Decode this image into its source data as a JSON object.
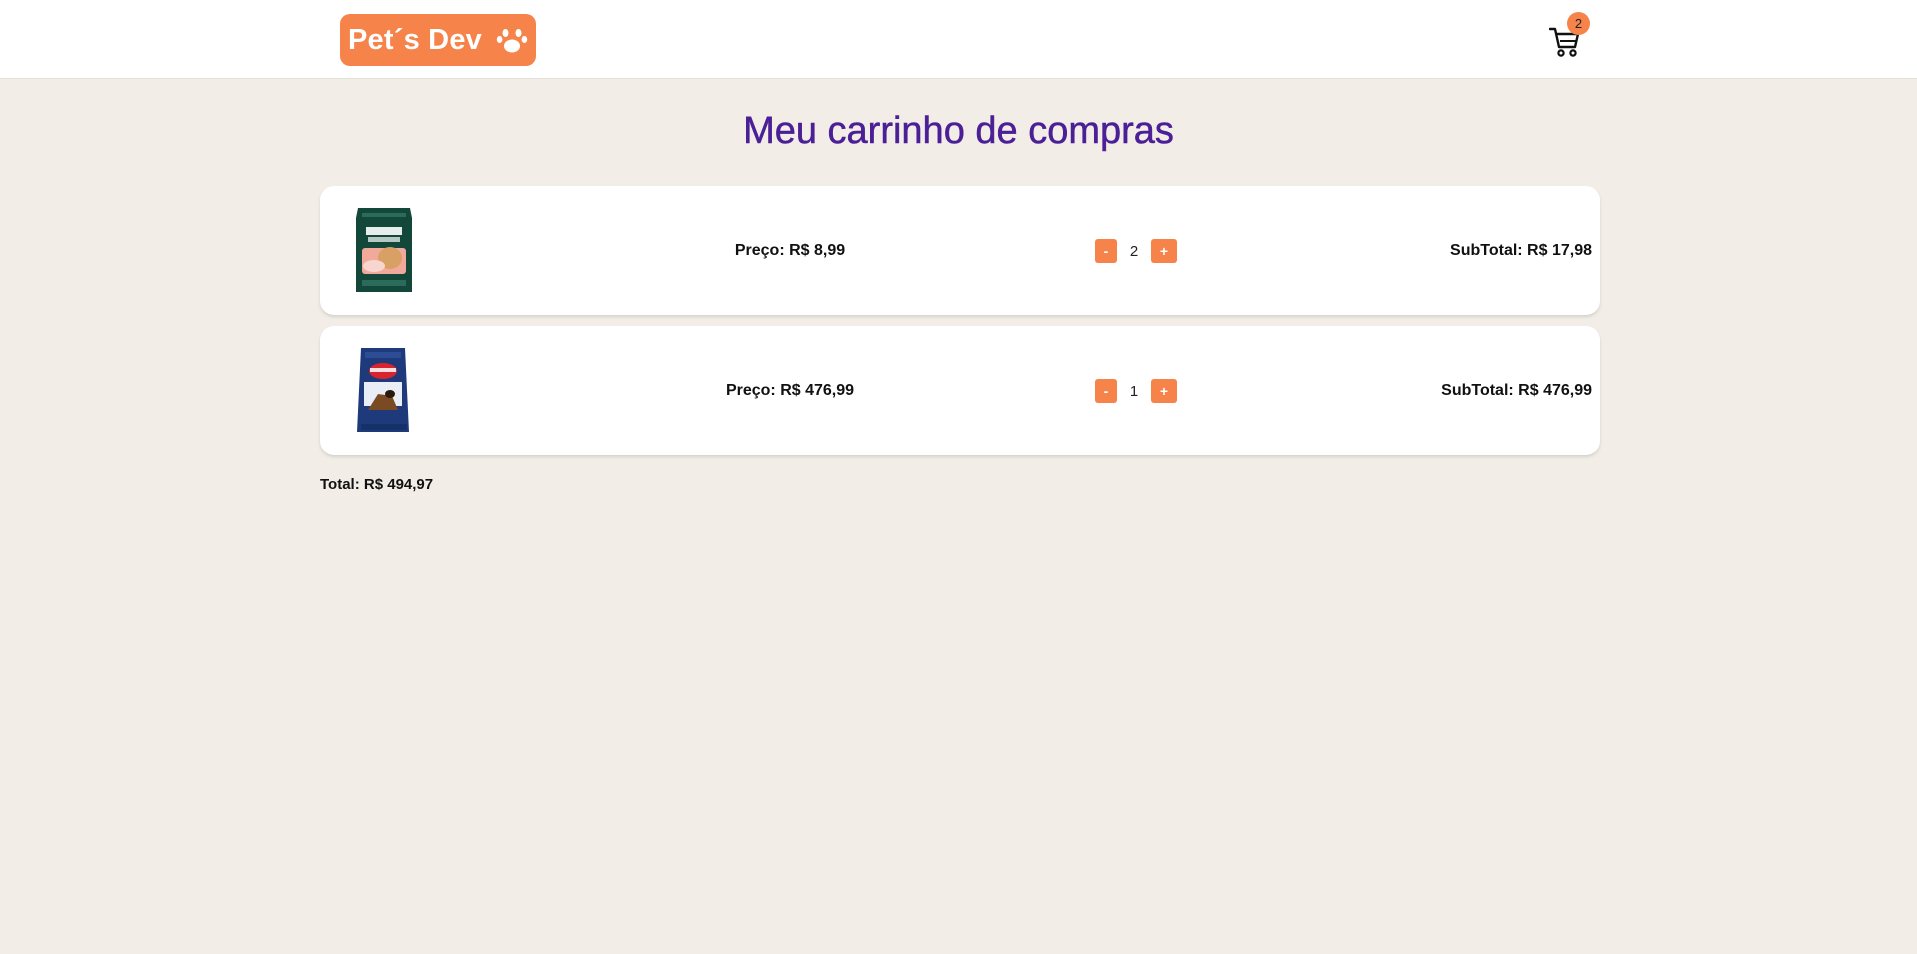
{
  "header": {
    "logo_text": "Pet´s Dev",
    "logo_icon": "paw-icon",
    "cart_icon": "cart-icon",
    "cart_count": "2"
  },
  "page": {
    "title": "Meu carrinho de compras"
  },
  "cart": {
    "items": [
      {
        "image": "PremieR Nattu wet food pouch",
        "price": "Preço: R$ 8,99",
        "quantity": "2",
        "decrement": "-",
        "increment": "+",
        "subtotal": "SubTotal: R$ 17,98"
      },
      {
        "image": "Royal Canin dry food bag",
        "price": "Preço: R$ 476,99",
        "quantity": "1",
        "decrement": "-",
        "increment": "+",
        "subtotal": "SubTotal: R$ 476,99"
      }
    ],
    "total": "Total: R$ 494,97"
  },
  "colors": {
    "accent": "#f5834a",
    "title": "#4b1f96",
    "background": "#f2ede7"
  }
}
